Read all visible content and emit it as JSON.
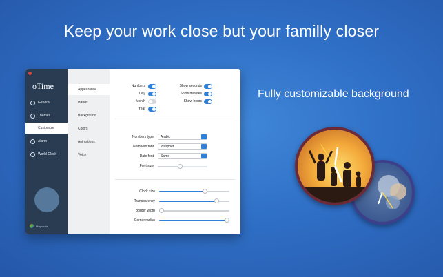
{
  "headline": "Keep your work close but your familly closer",
  "side_caption": "Fully customizable background",
  "app": {
    "logo": "oTime",
    "sidebar": [
      {
        "label": "General",
        "icon": "gear-icon"
      },
      {
        "label": "Themes",
        "icon": "clock-icon"
      },
      {
        "label": "Customize",
        "icon": ""
      },
      {
        "label": "Alarm",
        "icon": "alarm-icon"
      },
      {
        "label": "World Clock",
        "icon": "globe-icon"
      }
    ],
    "developer_logo": "Mogopala",
    "tabs": [
      "Appearance",
      "Hands",
      "Background",
      "Colors",
      "Animations",
      "Voice"
    ],
    "toggles_left": [
      {
        "label": "Numbers",
        "on": true
      },
      {
        "label": "Day",
        "on": true
      },
      {
        "label": "Month",
        "on": false
      },
      {
        "label": "Year",
        "on": true
      }
    ],
    "toggles_right": [
      {
        "label": "Show seconds",
        "on": true
      },
      {
        "label": "Show minutes",
        "on": true
      },
      {
        "label": "Show hours",
        "on": true
      }
    ],
    "numbers_type": {
      "label": "Numbers type",
      "value": "Arabic"
    },
    "numbers_font": {
      "label": "Numbers font",
      "value": "Wallpoet"
    },
    "date_font": {
      "label": "Date font",
      "value": "Same"
    },
    "font_size": {
      "label": "Font size",
      "value": 0.45
    },
    "clock_size": {
      "label": "Clock size",
      "value": 0.65
    },
    "transparency": {
      "label": "Transparency",
      "value": 0.82
    },
    "border_width": {
      "label": "Border width",
      "value": 0.02
    },
    "corner_radius": {
      "label": "Corner radius",
      "value": 0.98
    }
  }
}
